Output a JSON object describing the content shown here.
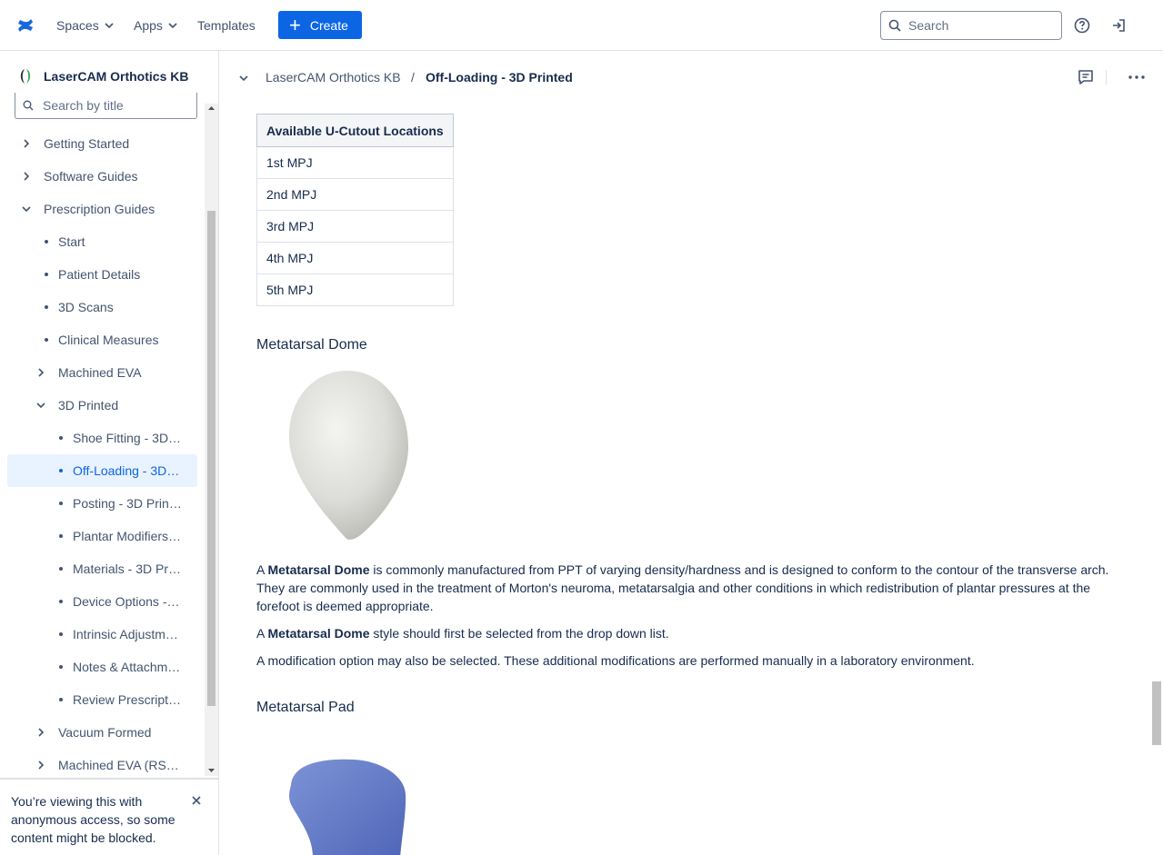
{
  "topbar": {
    "spaces_label": "Spaces",
    "apps_label": "Apps",
    "templates_label": "Templates",
    "create_label": "Create",
    "search_placeholder": "Search",
    "accent": "#0c66e4"
  },
  "sidebar": {
    "space_name": "LaserCAM Orthotics KB",
    "search_placeholder": "Search by title",
    "items": [
      {
        "label": "Getting Started",
        "type": "collapsed",
        "level": 0
      },
      {
        "label": "Software Guides",
        "type": "collapsed",
        "level": 0
      },
      {
        "label": "Prescription Guides",
        "type": "expanded",
        "level": 0
      },
      {
        "label": "Start",
        "type": "bullet",
        "level": 1
      },
      {
        "label": "Patient Details",
        "type": "bullet",
        "level": 1
      },
      {
        "label": "3D Scans",
        "type": "bullet",
        "level": 1
      },
      {
        "label": "Clinical Measures",
        "type": "bullet",
        "level": 1
      },
      {
        "label": "Machined EVA",
        "type": "collapsed",
        "level": 1
      },
      {
        "label": "3D Printed",
        "type": "expanded",
        "level": 1
      },
      {
        "label": "Shoe Fitting - 3D…",
        "type": "bullet",
        "level": 2
      },
      {
        "label": "Off-Loading - 3D…",
        "type": "bullet",
        "level": 2,
        "selected": true
      },
      {
        "label": "Posting - 3D Prin…",
        "type": "bullet",
        "level": 2
      },
      {
        "label": "Plantar Modifiers…",
        "type": "bullet",
        "level": 2
      },
      {
        "label": "Materials - 3D Pr…",
        "type": "bullet",
        "level": 2
      },
      {
        "label": "Device Options -…",
        "type": "bullet",
        "level": 2
      },
      {
        "label": "Intrinsic Adjustm…",
        "type": "bullet",
        "level": 2
      },
      {
        "label": "Notes & Attachm…",
        "type": "bullet",
        "level": 2
      },
      {
        "label": "Review Prescript…",
        "type": "bullet",
        "level": 2
      },
      {
        "label": "Vacuum Formed",
        "type": "collapsed",
        "level": 1
      },
      {
        "label": "Machined EVA (RS…",
        "type": "collapsed",
        "level": 1
      }
    ],
    "notice": "You’re viewing this with anonymous access, so some content might be blocked."
  },
  "breadcrumb": {
    "space": "LaserCAM Orthotics KB",
    "separator": "/",
    "page": "Off-Loading - 3D Printed"
  },
  "content": {
    "table": {
      "header": "Available U-Cutout Locations",
      "rows": [
        "1st MPJ",
        "2nd MPJ",
        "3rd MPJ",
        "4th MPJ",
        "5th MPJ"
      ]
    },
    "dome_heading": "Metatarsal Dome",
    "dome_p1_a": "A ",
    "dome_p1_b": "Metatarsal Dome",
    "dome_p1_c": " is commonly manufactured from PPT of varying density/hardness and is designed to conform to the contour of the transverse arch. They are commonly used in the treatment of Morton's neuroma, metatarsalgia and other conditions in which redistribution of plantar pressures at the forefoot is deemed appropriate.",
    "dome_p2_a": "A ",
    "dome_p2_b": "Metatarsal Dome",
    "dome_p2_c": " style should first be selected from the drop down list.",
    "dome_p3": "A modification option may also be selected. These additional modifications are performed manually in a laboratory environment.",
    "pad_heading": "Metatarsal Pad"
  }
}
